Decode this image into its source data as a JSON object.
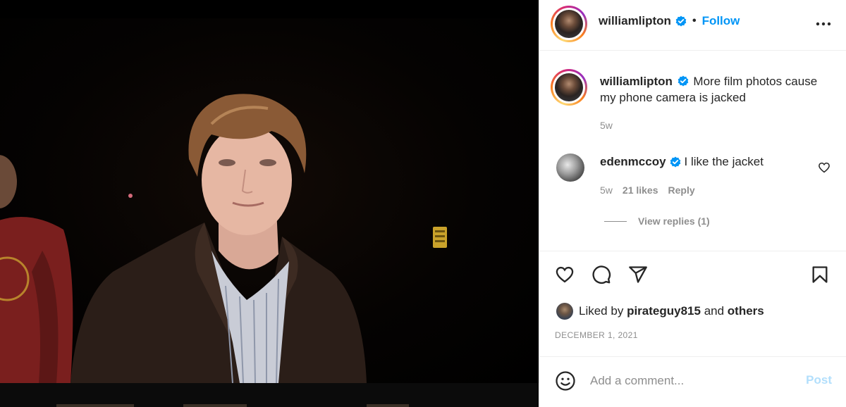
{
  "post": {
    "author": "williamlipton",
    "follow_label": "Follow",
    "separator": "•",
    "caption": "More film photos cause my phone camera is jacked",
    "caption_age": "5w",
    "comments": [
      {
        "user": "edenmccoy",
        "text": "I like the jacket",
        "age": "5w",
        "likes": "21 likes",
        "reply_label": "Reply",
        "view_replies": "View replies (1)"
      }
    ],
    "liked_by_prefix": "Liked by",
    "liked_by_user": "pirateguy815",
    "liked_by_and": "and",
    "liked_by_others": "others",
    "date": "DECEMBER 1, 2021",
    "comment_placeholder": "Add a comment...",
    "post_label": "Post"
  },
  "icons": {
    "verified": "verified-badge-icon",
    "more": "more-options-icon",
    "like": "heart-icon",
    "comment": "comment-icon",
    "share": "share-icon",
    "save": "bookmark-icon",
    "emoji": "emoji-icon"
  },
  "colors": {
    "accent": "#0095f6",
    "post_disabled": "#b2dffc",
    "muted": "#8e8e8e",
    "text": "#262626"
  }
}
